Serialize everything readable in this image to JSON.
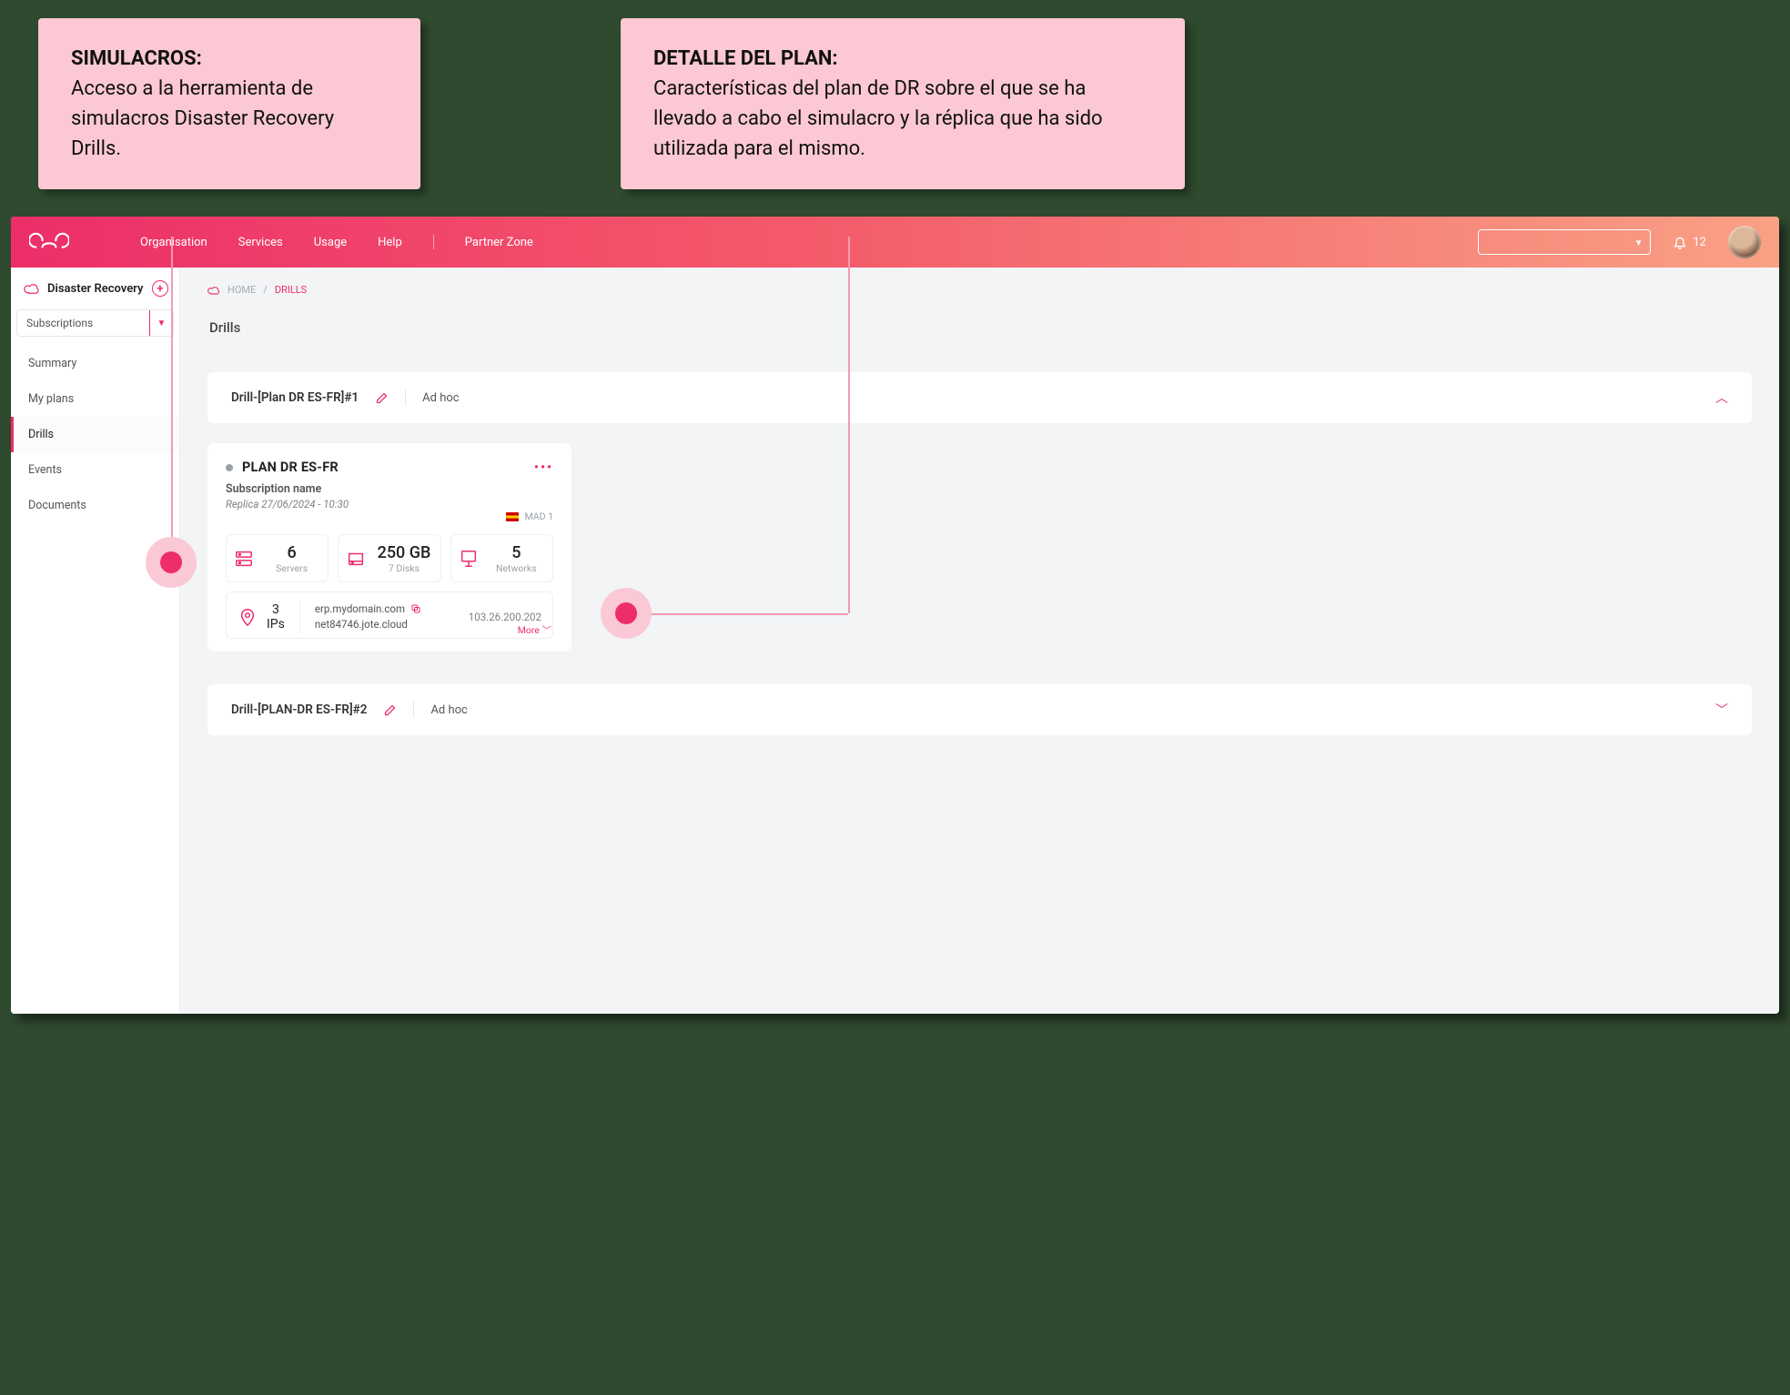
{
  "callouts": {
    "left": {
      "title": "SIMULACROS:",
      "body": "Acceso a la herramienta de simulacros Disaster Recovery Drills."
    },
    "right": {
      "title": "DETALLE DEL PLAN:",
      "body": "Características del plan de DR sobre el que se ha llevado a cabo el simulacro y la réplica que ha sido utilizada para el mismo."
    }
  },
  "colors": {
    "brand": "#ed2e69",
    "callout_bg": "#fcc8d4"
  },
  "topnav": {
    "items": [
      "Organisation",
      "Services",
      "Usage",
      "Help"
    ],
    "partner": "Partner Zone",
    "notif_count": "12",
    "select_caret": "▾"
  },
  "sidebar": {
    "title": "Disaster Recovery",
    "selector_label": "Subscriptions",
    "items": [
      {
        "label": "Summary",
        "active": false
      },
      {
        "label": "My plans",
        "active": false
      },
      {
        "label": "Drills",
        "active": true
      },
      {
        "label": "Events",
        "active": false
      },
      {
        "label": "Documents",
        "active": false
      }
    ]
  },
  "breadcrumbs": {
    "home": "HOME",
    "sep": "/",
    "current": "DRILLS"
  },
  "page_title": "Drills",
  "drills": [
    {
      "name": "Drill-[Plan DR ES-FR]#1",
      "mode": "Ad hoc",
      "expanded": true
    },
    {
      "name": "Drill-[PLAN-DR ES-FR]#2",
      "mode": "Ad hoc",
      "expanded": false
    }
  ],
  "plan": {
    "name": "PLAN DR ES-FR",
    "subscription": "Subscription name",
    "replica": "Replica 27/06/2024 - 10:30",
    "location": "MAD 1",
    "stats": {
      "servers": {
        "value": "6",
        "label": "Servers"
      },
      "storage": {
        "value": "250 GB",
        "label": "7 Disks"
      },
      "networks": {
        "value": "5",
        "label": "Networks"
      },
      "ips": {
        "value": "3",
        "label": "IPs"
      }
    },
    "domain_primary": "erp.mydomain.com",
    "domain_secondary": "net84746.jote.cloud",
    "ip": "103.26.200.202",
    "more": "More"
  },
  "glyphs": {
    "chev_up": "︿",
    "chev_down": "﹀",
    "more_dots": "•••",
    "plus": "+",
    "caret": "▼"
  }
}
